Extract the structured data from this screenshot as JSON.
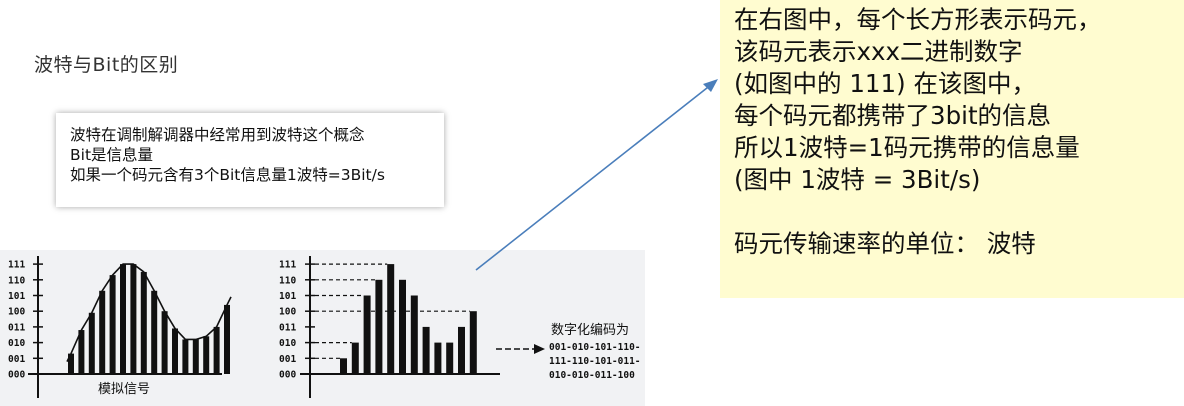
{
  "title": "波特与Bit的区别",
  "note": {
    "lines": [
      "波特在调制解调器中经常用到波特这个概念",
      "Bit是信息量",
      "如果一个码元含有3个Bit信息量1波特=3Bit/s"
    ]
  },
  "callout": {
    "lines": [
      "在右图中，每个长方形表示码元，",
      "该码元表示xxx二进制数字",
      "(如图中的 111) 在该图中，",
      "每个码元都携带了3bit的信息",
      "所以1波特=1码元携带的信息量",
      "(图中 1波特 = 3Bit/s)",
      "",
      "码元传输速率的单位： 波特"
    ]
  },
  "diagram": {
    "level_labels": [
      "111",
      "110",
      "101",
      "100",
      "011",
      "010",
      "001",
      "000"
    ],
    "left_caption": "模拟信号",
    "right_caption": "数字化编码为",
    "code_lines": [
      "001-010-101-110-",
      "111-110-101-011-",
      "010-010-011-100"
    ],
    "left_bars": [
      1.3,
      2.8,
      3.9,
      5.3,
      6.3,
      7.0,
      7.0,
      6.5,
      5.3,
      4.0,
      2.9,
      2.2,
      2.2,
      2.4,
      3.0,
      4.4
    ],
    "right_bars": [
      1,
      2,
      5,
      6,
      7,
      6,
      5,
      3,
      2,
      2,
      3,
      4
    ],
    "dashed_levels": [
      7,
      6,
      5,
      4,
      2,
      1
    ]
  },
  "arrow_color": "#4a7ebb",
  "callout_bg": "#fffcd0"
}
